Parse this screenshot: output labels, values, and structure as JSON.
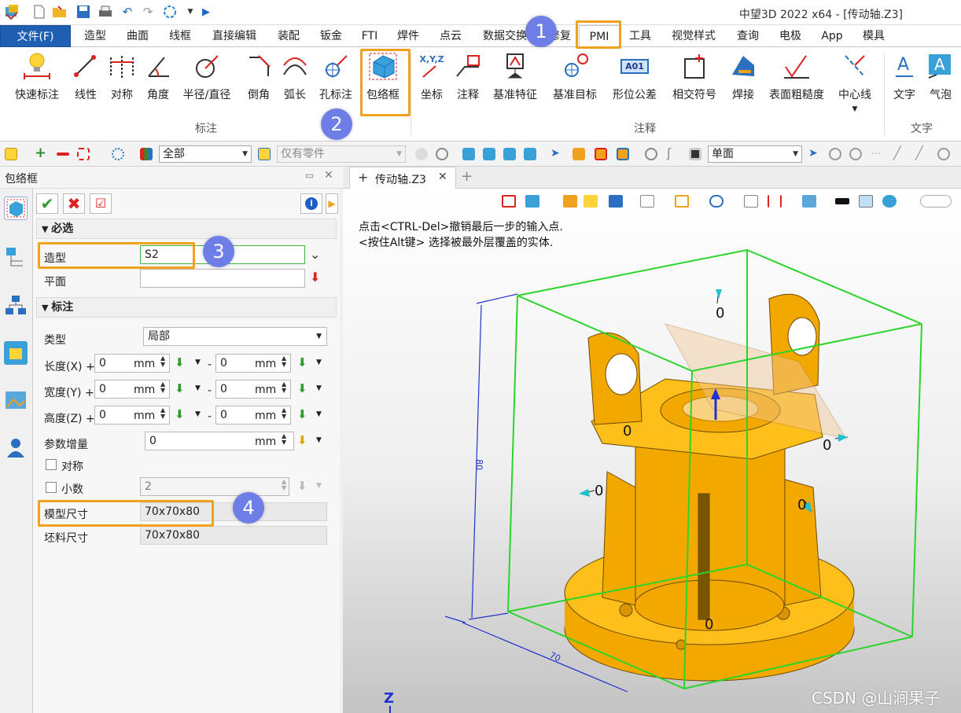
{
  "window": {
    "title": "中望3D 2022 x64 - [传动轴.Z3]"
  },
  "menu": {
    "file": "文件(F)",
    "tabs": [
      "造型",
      "曲面",
      "线框",
      "直接编辑",
      "装配",
      "钣金",
      "FTI",
      "焊件",
      "点云",
      "数据交换",
      "修复",
      "PMI",
      "工具",
      "视觉样式",
      "查询",
      "电极",
      "App",
      "模具"
    ]
  },
  "ribbon": {
    "tools": [
      "快速标注",
      "线性",
      "对称",
      "角度",
      "半径/直径",
      "倒角",
      "弧长",
      "孔标注",
      "包络框",
      "坐标",
      "注释",
      "基准特征",
      "基准目标",
      "形位公差",
      "相交符号",
      "焊接",
      "表面粗糙度",
      "中心线",
      "文字",
      "气泡"
    ],
    "groups": [
      "标注",
      "注释",
      "文字"
    ],
    "coord_icon_text": "X,Y,Z",
    "gdt_icon_text": "A01"
  },
  "toolbar": {
    "filter_all": "全部",
    "filter_parts": "仅有零件",
    "view_mode": "单面"
  },
  "panel": {
    "title": "包络框"
  },
  "form": {
    "section_required": "必选",
    "shape_label": "造型",
    "shape_value": "S2",
    "plane_label": "平面",
    "section_annot": "标注",
    "type_label": "类型",
    "type_value": "局部",
    "length_label": "长度(X)",
    "width_label": "宽度(Y)",
    "height_label": "高度(Z)",
    "plus": "+",
    "minus": "-",
    "zero": "0",
    "unit": "mm",
    "param_label": "参数增量",
    "param_value": "0",
    "symmetric_label": "对称",
    "decimal_label": "小数",
    "decimal_value": "2",
    "model_size_label": "模型尺寸",
    "model_size_value": "70x70x80",
    "blank_size_label": "坯料尺寸",
    "blank_size_value": "70x70x80"
  },
  "doc": {
    "tab": "传动轴.Z3",
    "add": "+"
  },
  "viewport": {
    "prompt1": "点击<CTRL-Del>撤销最后一步的输入点.",
    "prompt2": "<按住Alt键> 选择被最外层覆盖的实体.",
    "dim_zero": "0",
    "axis_z": "Z",
    "dim_tag_v": "80",
    "dim_tag_b": "70"
  },
  "badges": [
    "1",
    "2",
    "3",
    "4"
  ],
  "watermark": "CSDN @山涧果子",
  "colors": {
    "part": "#f3a800",
    "bbox": "#2ad42a",
    "dim": "#2233cc",
    "accent": "#1f5fb3",
    "highlight": "#f0a21e",
    "badge": "#6d7fe6"
  }
}
